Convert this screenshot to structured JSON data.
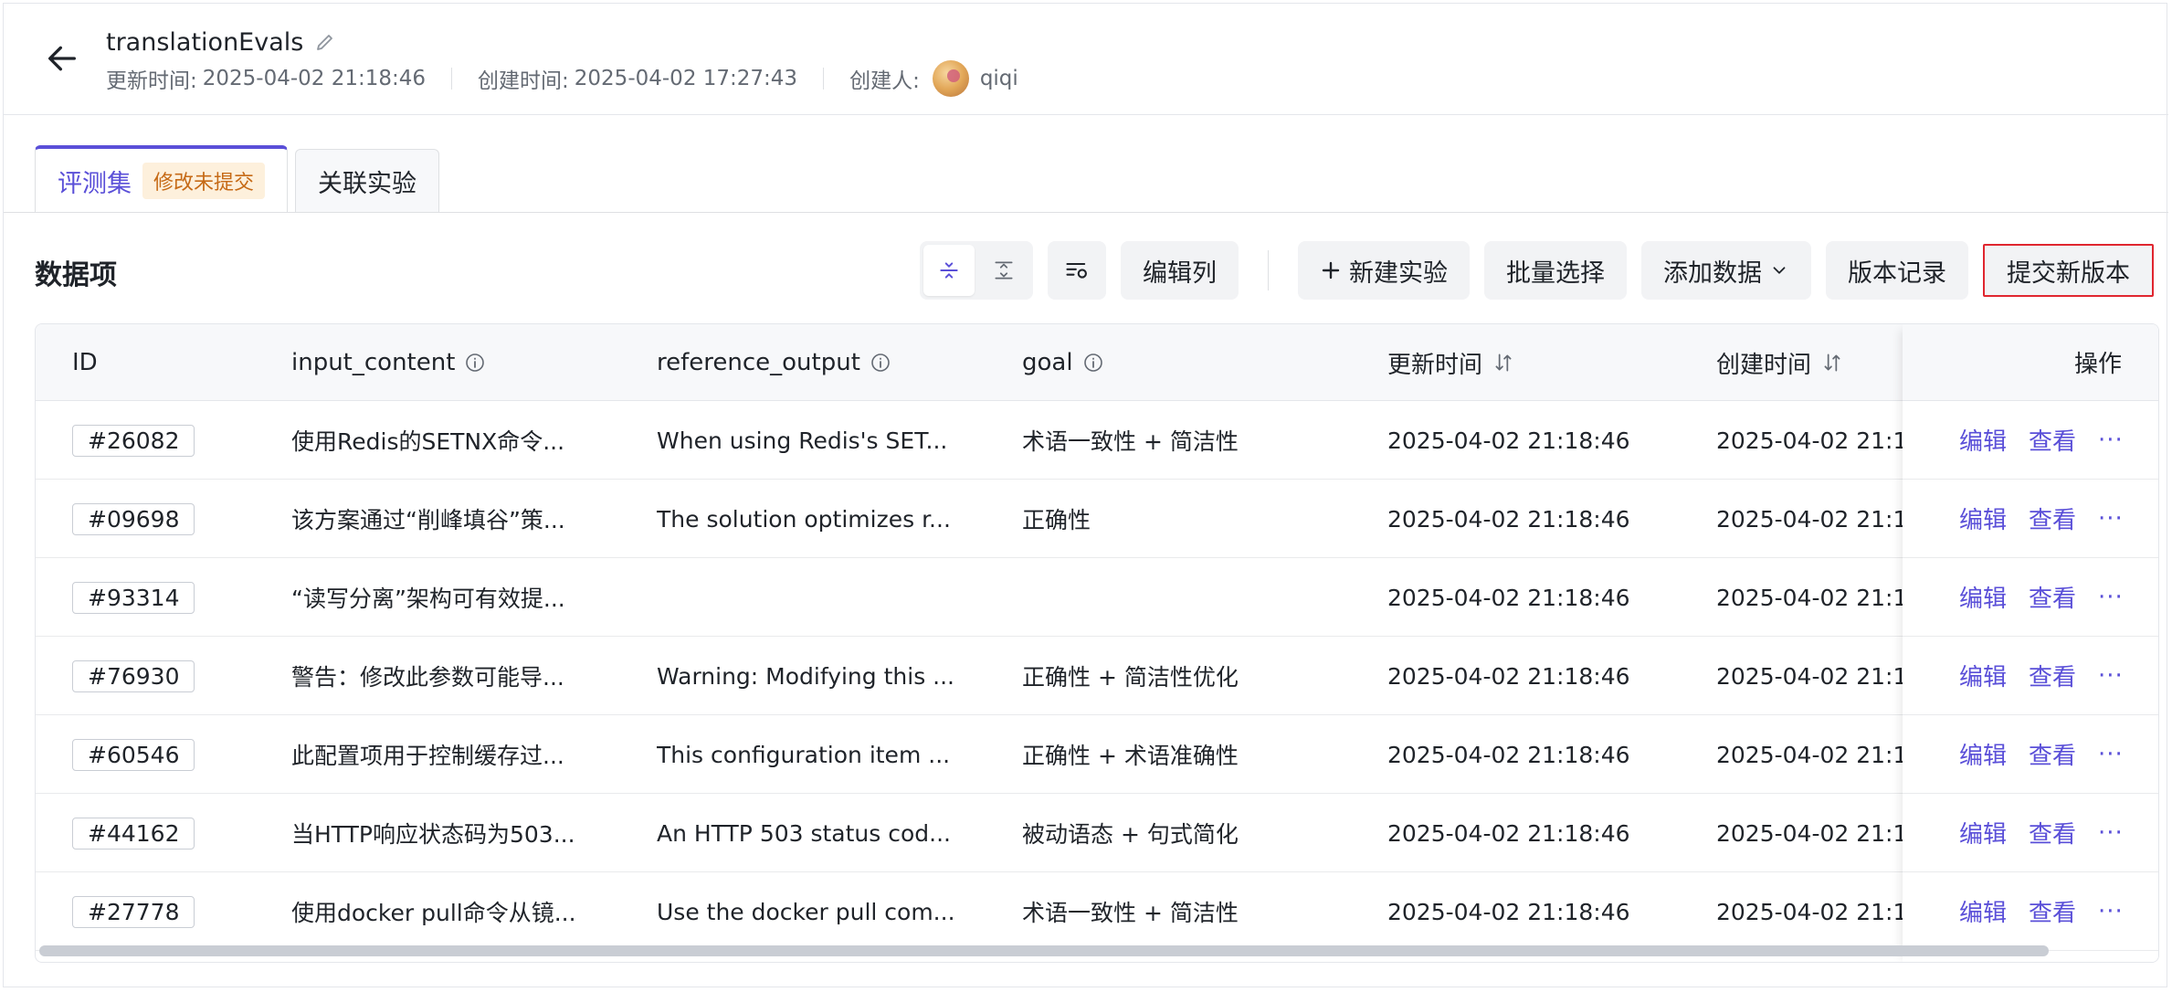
{
  "header": {
    "title": "translationEvals",
    "updated_label": "更新时间:",
    "updated_value": "2025-04-02 21:18:46",
    "created_label": "创建时间:",
    "created_value": "2025-04-02 17:27:43",
    "creator_label": "创建人:",
    "creator_name": "qiqi"
  },
  "tabs": [
    {
      "label": "评测集",
      "badge": "修改未提交",
      "active": true
    },
    {
      "label": "关联实验",
      "active": false
    }
  ],
  "section": {
    "title": "数据项"
  },
  "toolbar": {
    "edit_columns": "编辑列",
    "new_experiment": "新建实验",
    "batch_select": "批量选择",
    "add_data": "添加数据",
    "version_history": "版本记录",
    "submit_version": "提交新版本"
  },
  "table": {
    "columns": {
      "id": "ID",
      "input_content": "input_content",
      "reference_output": "reference_output",
      "goal": "goal",
      "updated_at": "更新时间",
      "created_at": "创建时间",
      "actions": "操作"
    },
    "action_labels": {
      "edit": "编辑",
      "view": "查看",
      "more": "···"
    },
    "rows": [
      {
        "id": "#26082",
        "input": "使用Redis的SETNX命令...",
        "ref": "When using Redis's SET...",
        "goal": "术语一致性 + 简洁性",
        "updated": "2025-04-02 21:18:46",
        "created": "2025-04-02 21:1"
      },
      {
        "id": "#09698",
        "input": "该方案通过“削峰填谷”策...",
        "ref": "The solution optimizes r...",
        "goal": "正确性",
        "updated": "2025-04-02 21:18:46",
        "created": "2025-04-02 21:1"
      },
      {
        "id": "#93314",
        "input": "“读写分离”架构可有效提...",
        "ref": "",
        "goal": "",
        "updated": "2025-04-02 21:18:46",
        "created": "2025-04-02 21:1"
      },
      {
        "id": "#76930",
        "input": "警告：修改此参数可能导...",
        "ref": "Warning: Modifying this ...",
        "goal": "正确性 + 简洁性优化",
        "updated": "2025-04-02 21:18:46",
        "created": "2025-04-02 21:1"
      },
      {
        "id": "#60546",
        "input": "此配置项用于控制缓存过...",
        "ref": "This configuration item ...",
        "goal": "正确性 + 术语准确性",
        "updated": "2025-04-02 21:18:46",
        "created": "2025-04-02 21:1"
      },
      {
        "id": "#44162",
        "input": "当HTTP响应状态码为503...",
        "ref": "An HTTP 503 status cod...",
        "goal": "被动语态 + 句式简化",
        "updated": "2025-04-02 21:18:46",
        "created": "2025-04-02 21:1"
      },
      {
        "id": "#27778",
        "input": "使用docker pull命令从镜...",
        "ref": "Use the docker pull com...",
        "goal": "术语一致性 + 简洁性",
        "updated": "2025-04-02 21:18:46",
        "created": "2025-04-02 21:1"
      }
    ]
  },
  "colors": {
    "accent": "#5a4fd8",
    "badge_bg": "#fdf0dc",
    "badge_text": "#c66a16",
    "highlight_border": "#e0262f"
  }
}
